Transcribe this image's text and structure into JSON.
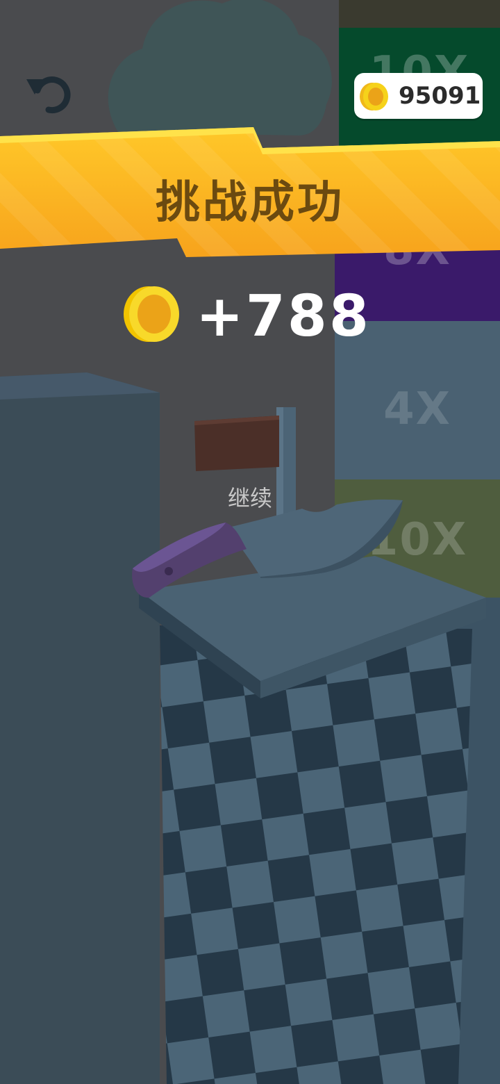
{
  "hud": {
    "coin_total": "95091",
    "restart_icon": "restart-icon",
    "coin_icon": "coin-icon"
  },
  "result": {
    "title": "挑战成功",
    "reward": "+788"
  },
  "continue_label": "继续",
  "multipliers": [
    {
      "label": "10X",
      "color": "#064a2e"
    },
    {
      "label": "8X",
      "color": "#3b1a6b"
    },
    {
      "label": "4X",
      "color": "#49606f"
    },
    {
      "label": "10X",
      "color": "#4f5d3e"
    }
  ],
  "colors": {
    "banner_yellow": "#ffc726",
    "banner_orange": "#f7a21b",
    "coin_gold": "#f6c30f",
    "coin_inner": "#eba318"
  }
}
